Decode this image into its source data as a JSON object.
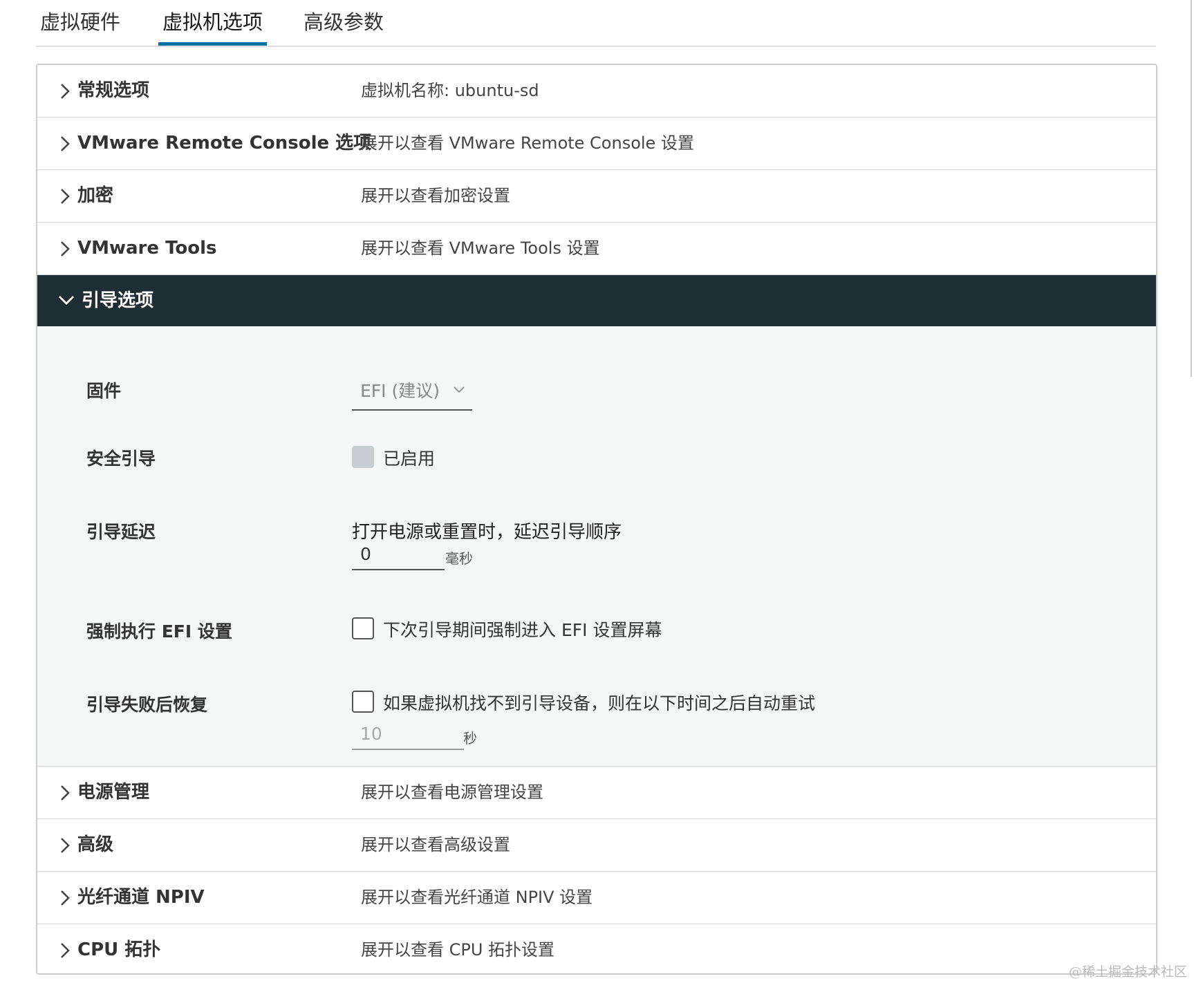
{
  "tabs": [
    {
      "label": "虚拟硬件",
      "active": false
    },
    {
      "label": "虚拟机选项",
      "active": true
    },
    {
      "label": "高级参数",
      "active": false
    }
  ],
  "sections": {
    "general": {
      "label": "常规选项",
      "desc": "虚拟机名称: ubuntu-sd"
    },
    "vmrc": {
      "label": "VMware Remote Console 选项",
      "desc": "展开以查看 VMware Remote Console 设置"
    },
    "encryption": {
      "label": "加密",
      "desc": "展开以查看加密设置"
    },
    "tools": {
      "label": "VMware Tools",
      "desc": "展开以查看 VMware Tools 设置"
    },
    "power": {
      "label": "电源管理",
      "desc": "展开以查看电源管理设置"
    },
    "advanced": {
      "label": "高级",
      "desc": "展开以查看高级设置"
    },
    "npiv": {
      "label": "光纤通道 NPIV",
      "desc": "展开以查看光纤通道 NPIV 设置"
    },
    "cpu": {
      "label": "CPU 拓扑",
      "desc": "展开以查看 CPU 拓扑设置"
    }
  },
  "boot": {
    "label": "引导选项",
    "firmware": {
      "label": "固件",
      "value": "EFI (建议)"
    },
    "secure_boot": {
      "label": "安全引导",
      "checkbox_label": "已启用",
      "checked": false,
      "disabled": true
    },
    "boot_delay": {
      "label": "引导延迟",
      "heading": "打开电源或重置时，延迟引导顺序",
      "value": "0",
      "unit": "毫秒"
    },
    "force_efi": {
      "label": "强制执行 EFI 设置",
      "checkbox_label": "下次引导期间强制进入 EFI 设置屏幕",
      "checked": false
    },
    "failed_boot": {
      "label": "引导失败后恢复",
      "checkbox_label": "如果虚拟机找不到引导设备，则在以下时间之后自动重试",
      "checked": false,
      "value": "10",
      "unit": "秒"
    }
  },
  "watermark": "@稀土掘金技术社区",
  "icons": {
    "collapsed": "chevron-right-icon",
    "expanded": "chevron-down-icon",
    "dropdown": "caret-down-icon"
  },
  "colors": {
    "accent": "#0072a3",
    "expanded_header": "#1f2d35",
    "expanded_body": "#f5f6f6"
  }
}
